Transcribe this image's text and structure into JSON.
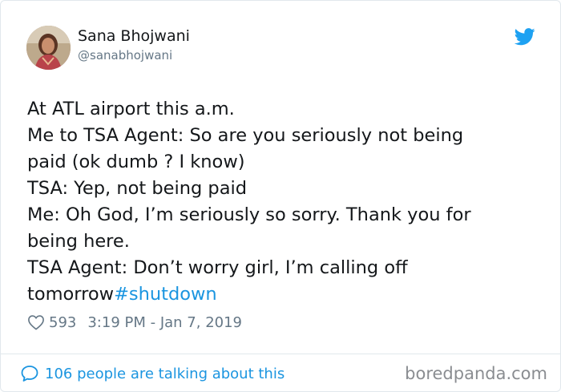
{
  "author": {
    "name": "Sana Bhojwani",
    "handle": "@sanabhojwani"
  },
  "tweet": {
    "lines": [
      "At ATL airport this a.m.",
      "Me to TSA Agent: So are you seriously not being",
      "paid (ok dumb ? I know)",
      "TSA: Yep, not being paid",
      "Me: Oh God, I’m seriously so sorry. Thank you for",
      "being here.",
      "TSA Agent: Don’t worry girl, I’m calling off"
    ],
    "last_line_text": "tomorrow",
    "hashtag": "#shutdown"
  },
  "meta": {
    "likes": "593",
    "timestamp": "3:19 PM - Jan 7, 2019"
  },
  "footer": {
    "talking": "106 people are talking about this",
    "watermark": "boredpanda.com"
  },
  "icons": {
    "brand": "twitter-bird-icon",
    "like": "heart-icon",
    "reply": "speech-bubble-icon"
  },
  "colors": {
    "link": "#1b95e0",
    "secondary": "#657786",
    "text": "#14171a"
  }
}
